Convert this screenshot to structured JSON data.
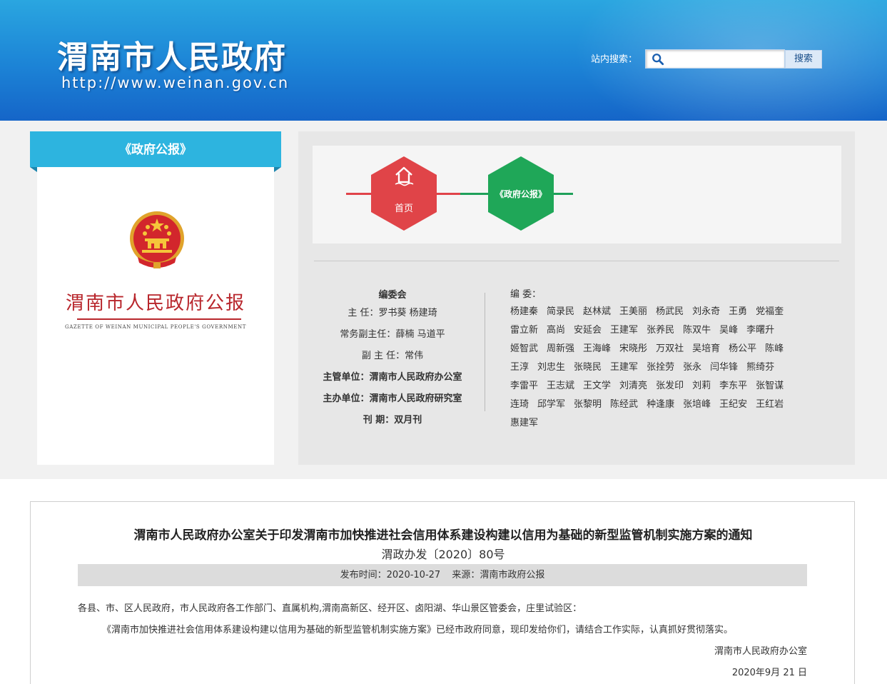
{
  "header": {
    "site_title": "渭南市人民政府",
    "site_url": "http://www.weinan.gov.cn",
    "search_label": "站内搜索：",
    "search_value": "",
    "search_button": "搜索"
  },
  "left": {
    "tab_label": "《政府公报》",
    "cover_title": "渭南市人民政府公报",
    "cover_subtitle": "GAZETTE OF WEINAN MUNICIPAL PEOPLE'S GOVERNMENT"
  },
  "nav": {
    "home_label": "首页",
    "gazette_label": "《政府公报》"
  },
  "committee": {
    "heading": "编委会",
    "rows": [
      {
        "key": "主 任：",
        "value": "罗书葵  杨建琦"
      },
      {
        "key": "常务副主任：",
        "value": "薛楠  马道平"
      },
      {
        "key": "副 主 任：",
        "value": "常伟"
      },
      {
        "key": "主管单位：",
        "value": "渭南市人民政府办公室"
      },
      {
        "key": "主办单位：",
        "value": "渭南市人民政府研究室"
      },
      {
        "key": "刊 期：",
        "value": "双月刊"
      }
    ]
  },
  "editors": {
    "heading": "编  委：",
    "rows": [
      [
        "杨建秦",
        "简录民",
        "赵林斌",
        "王美丽",
        "杨武民",
        "刘永奇",
        "王勇",
        "党福奎"
      ],
      [
        "雷立新",
        "高尚",
        "安延会",
        "王建军",
        "张养民",
        "陈双牛",
        "吴峰",
        "李曙升"
      ],
      [
        "姬智武",
        "周新强",
        "王海峰",
        "宋晓彤",
        "万双社",
        "吴培育",
        "杨公平",
        "陈峰"
      ],
      [
        "王淳",
        "刘忠生",
        "张晓民",
        "王建军",
        "张拴劳",
        "张永",
        "闫华锋",
        "熊绮芬"
      ],
      [
        "李雷平",
        "王志斌",
        "王文学",
        "刘清亮",
        "张发印",
        "刘莉",
        "李东平",
        "张智谋"
      ],
      [
        "连琦",
        "邱学军",
        "张黎明",
        "陈经武",
        "种逢康",
        "张培峰",
        "王纪安",
        "王红岩"
      ],
      [
        "惠建军"
      ]
    ]
  },
  "article": {
    "title": "渭南市人民政府办公室关于印发渭南市加快推进社会信用体系建设构建以信用为基础的新型监管机制实施方案的通知",
    "doc_no": "渭政办发〔2020〕80号",
    "publish_time": "发布时间：2020-10-27",
    "source": "来源：渭南市政府公报",
    "para1": "各县、市、区人民政府，市人民政府各工作部门、直属机构,渭南高新区、经开区、卤阳湖、华山景区管委会，庄里试验区：",
    "para2": "《渭南市加快推进社会信用体系建设构建以信用为基础的新型监管机制实施方案》已经市政府同意，现印发给你们，请结合工作实际，认真抓好贯彻落实。",
    "signature": "渭南市人民政府办公室",
    "date": "2020年9月 21 日"
  },
  "colors": {
    "header_blue": "#1c83d6",
    "tab_blue": "#2db4df",
    "home_red": "#e04448",
    "gazette_green": "#1fa758",
    "cover_red": "#b8262c"
  },
  "icons": [
    "search-icon",
    "home-icon",
    "national-emblem-icon"
  ]
}
